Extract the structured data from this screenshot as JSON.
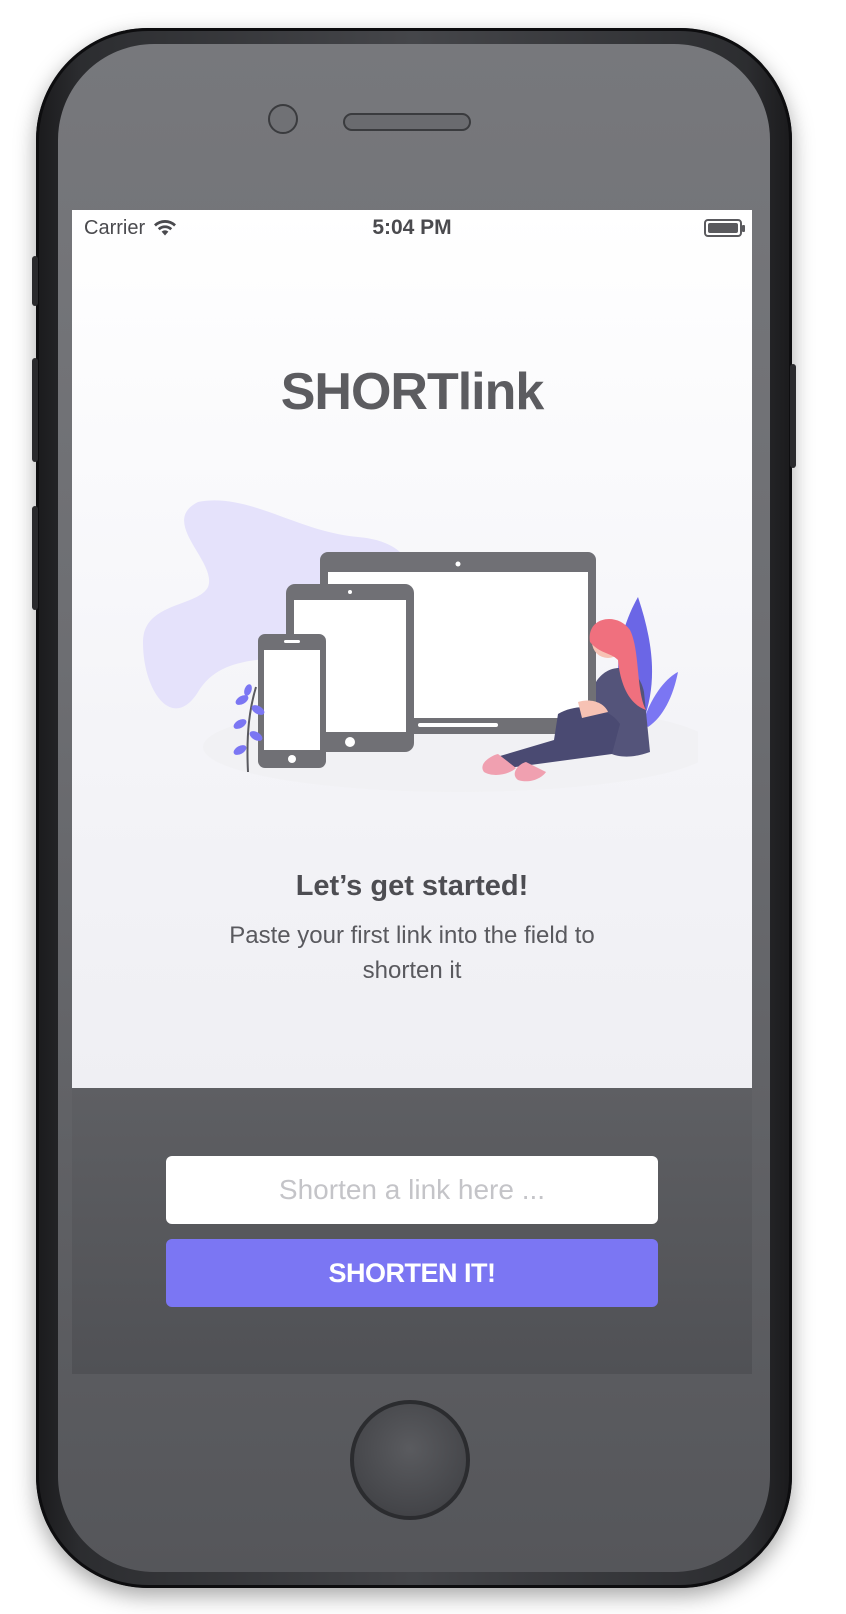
{
  "status_bar": {
    "carrier": "Carrier",
    "time": "5:04 PM"
  },
  "app": {
    "title": "SHORTlink",
    "headline": "Let’s get started!",
    "subtext": "Paste your first link into the field to shorten it"
  },
  "form": {
    "input_placeholder": "Shorten a link here ...",
    "input_value": "",
    "button_label": "SHORTEN IT!"
  },
  "colors": {
    "accent": "#7b76f3",
    "blob": "#e5e2fb",
    "device": "#707075",
    "hair": "#f0707e",
    "plant": "#7b76f3"
  },
  "icons": [
    "wifi-icon",
    "battery-icon",
    "home-button"
  ]
}
